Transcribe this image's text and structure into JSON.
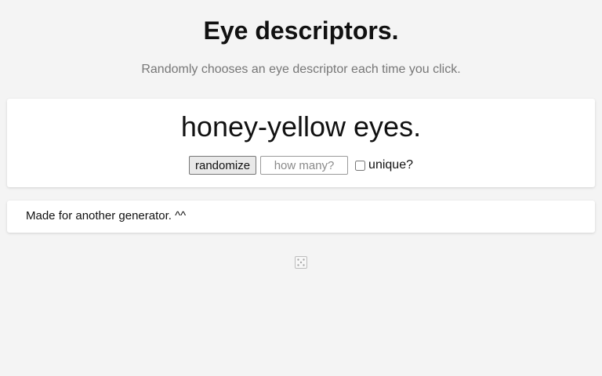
{
  "header": {
    "title": "Eye descriptors.",
    "subtitle": "Randomly chooses an eye descriptor each time you click."
  },
  "generator": {
    "output": "honey-yellow eyes.",
    "randomize_label": "randomize",
    "count_placeholder": "how many?",
    "count_value": "",
    "unique_label": "unique?",
    "unique_checked": false
  },
  "footer": {
    "text": "Made for another generator. ^^"
  },
  "icons": {
    "dice": "dice-icon"
  },
  "colors": {
    "background": "#f4f4f4",
    "card": "#ffffff",
    "subtitle": "#777777"
  }
}
